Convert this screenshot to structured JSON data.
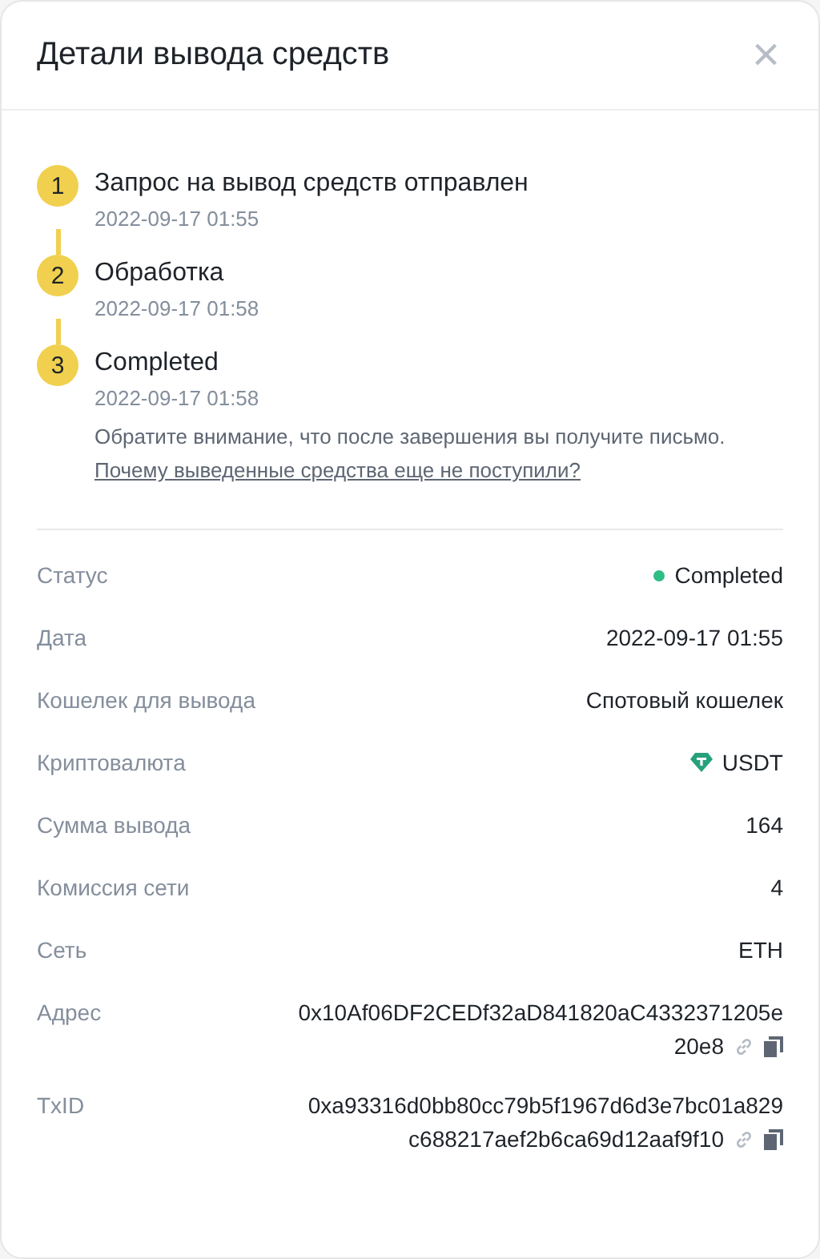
{
  "dialog": {
    "title": "Детали вывода средств",
    "close": "×"
  },
  "steps": [
    {
      "number": "1",
      "title": "Запрос на вывод средств отправлен",
      "time": "2022-09-17 01:55"
    },
    {
      "number": "2",
      "title": "Обработка",
      "time": "2022-09-17 01:58"
    },
    {
      "number": "3",
      "title": "Completed",
      "time": "2022-09-17 01:58",
      "note": "Обратите внимание, что после завершения вы получите письмо. ",
      "link": "Почему выведенные средства еще не поступили?"
    }
  ],
  "details": [
    {
      "kind": "status",
      "label": "Статус",
      "value": "Completed",
      "color": "#2ebd85"
    },
    {
      "kind": "text",
      "label": "Дата",
      "value": "2022-09-17 01:55"
    },
    {
      "kind": "text",
      "label": "Кошелек для вывода",
      "value": "Спотовый кошелек"
    },
    {
      "kind": "coin",
      "label": "Криптовалюта",
      "value": "USDT"
    },
    {
      "kind": "text",
      "label": "Сумма вывода",
      "value": "164"
    },
    {
      "kind": "text",
      "label": "Комиссия сети",
      "value": "4"
    },
    {
      "kind": "text",
      "label": "Сеть",
      "value": "ETH"
    },
    {
      "kind": "hash",
      "label": "Адрес",
      "lines": [
        "0x10Af06DF2CEDf32aD841820aC4332371205e",
        "20e8"
      ]
    },
    {
      "kind": "hash",
      "label": "TxID",
      "lines": [
        "0xa93316d0bb80cc79b5f1967d6d3e7bc01a829",
        "c688217aef2b6ca69d12aaf9f10"
      ]
    }
  ]
}
